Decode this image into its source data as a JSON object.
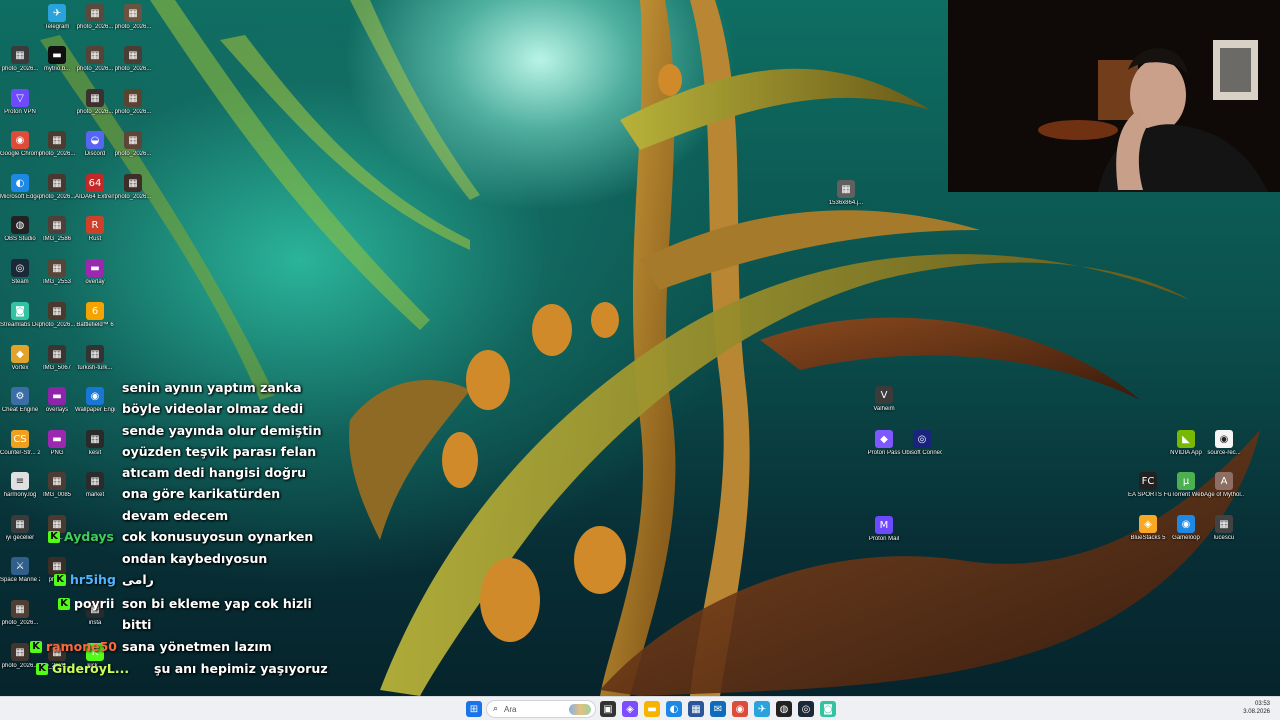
{
  "desktop": {
    "icons_left": [
      {
        "label": "Telegram",
        "color": "#2aa3dc",
        "glyph": "✈"
      },
      {
        "label": "photo_2026...",
        "color": "#5a4a3c",
        "glyph": "▦"
      },
      {
        "label": "photo_2026...",
        "color": "#6a5340",
        "glyph": "▦"
      },
      {
        "label": "photo_2026...",
        "color": "#3b3b3b",
        "glyph": "▦"
      },
      {
        "label": "mytrio.b...",
        "color": "#101010",
        "glyph": "▬"
      },
      {
        "label": "photo_2026...",
        "color": "#554338",
        "glyph": "▦"
      },
      {
        "label": "photo_2026...",
        "color": "#4a3d33",
        "glyph": "▦"
      },
      {
        "label": "Proton VPN",
        "color": "#6d4aff",
        "glyph": "▽"
      },
      {
        "label": "photo_2026...",
        "color": "#3c3030",
        "glyph": "▦"
      },
      {
        "label": "photo_2026...",
        "color": "#5b4332",
        "glyph": "▦"
      },
      {
        "label": "Google Chrome",
        "color": "#dd4b39",
        "glyph": "◉"
      },
      {
        "label": "photo_2026...",
        "color": "#4b3b30",
        "glyph": "▦"
      },
      {
        "label": "Discord",
        "color": "#5865f2",
        "glyph": "◒"
      },
      {
        "label": "photo_2026...",
        "color": "#5d4637",
        "glyph": "▦"
      },
      {
        "label": "Microsoft Edge",
        "color": "#1e88e5",
        "glyph": "◐"
      },
      {
        "label": "photo_2026...",
        "color": "#473830",
        "glyph": "▦"
      },
      {
        "label": "AIDA64 Extreme",
        "color": "#c62828",
        "glyph": "64"
      },
      {
        "label": "photo_2026...",
        "color": "#3c2f2a",
        "glyph": "▦"
      },
      {
        "label": "OBS Studio",
        "color": "#222222",
        "glyph": "◍"
      },
      {
        "label": "IMG_2586",
        "color": "#4e4038",
        "glyph": "▦"
      },
      {
        "label": "Rust",
        "color": "#cd412b",
        "glyph": "R"
      },
      {
        "label": "Steam",
        "color": "#1b2838",
        "glyph": "◎"
      },
      {
        "label": "IMG_2553",
        "color": "#574539",
        "glyph": "▦"
      },
      {
        "label": "overlay",
        "color": "#9c27b0",
        "glyph": "▬"
      },
      {
        "label": "Streamlabs Desktop",
        "color": "#31c3a2",
        "glyph": "◙"
      },
      {
        "label": "photo_2026...",
        "color": "#4a3a2e",
        "glyph": "▦"
      },
      {
        "label": "Battlefield™ 6",
        "color": "#f4a300",
        "glyph": "6"
      },
      {
        "label": "Vortex",
        "color": "#e3a32b",
        "glyph": "◆"
      },
      {
        "label": "IMG_5067",
        "color": "#3e3330",
        "glyph": "▦"
      },
      {
        "label": "turkish-turk...",
        "color": "#333333",
        "glyph": "▦"
      },
      {
        "label": "Cheat Engine",
        "color": "#3a6ea5",
        "glyph": "⚙"
      },
      {
        "label": "overlays",
        "color": "#8e24aa",
        "glyph": "▬"
      },
      {
        "label": "Wallpaper Engine",
        "color": "#1976d2",
        "glyph": "◉"
      },
      {
        "label": "Counter-Str... 2",
        "color": "#f0a020",
        "glyph": "CS"
      },
      {
        "label": "PNG",
        "color": "#9c27b0",
        "glyph": "▬"
      },
      {
        "label": "kesit",
        "color": "#2a2a2a",
        "glyph": "▦"
      },
      {
        "label": "harmony.log",
        "color": "#e0e0e0",
        "glyph": "≡"
      },
      {
        "label": "IMG_0085",
        "color": "#4d3c33",
        "glyph": "▦"
      },
      {
        "label": "market",
        "color": "#2b2b2b",
        "glyph": "▦"
      },
      {
        "label": "iyi gecelier",
        "color": "#3b3b3b",
        "glyph": "▦"
      },
      {
        "label": "ph...",
        "color": "#4a3b30",
        "glyph": "▦"
      },
      {
        "label": "Space Marine 2 (TL)",
        "color": "#2f5f8a",
        "glyph": "⚔"
      },
      {
        "label": "phot...",
        "color": "#3a2e28",
        "glyph": "▦"
      },
      {
        "label": "photo_2026...",
        "color": "#4f3e34",
        "glyph": "▦"
      },
      {
        "label": "insta",
        "color": "#2a2a2a",
        "glyph": "▦"
      },
      {
        "label": "photo_2026...",
        "color": "#423530",
        "glyph": "▦"
      },
      {
        "label": "to_2026...",
        "color": "#3d3029",
        "glyph": "▦"
      },
      {
        "label": "kick...",
        "color": "#53fc18",
        "glyph": "K"
      }
    ],
    "icons_center": [
      {
        "label": "1536x864.j...",
        "color": "#606060",
        "glyph": "▦"
      },
      {
        "label": "Valheim",
        "color": "#3b3b3b",
        "glyph": "V"
      },
      {
        "label": "Proton Pass",
        "color": "#7e57ff",
        "glyph": "◆"
      },
      {
        "label": "Ubisoft Connect",
        "color": "#1a237e",
        "glyph": "◎"
      },
      {
        "label": "Proton Mail",
        "color": "#6d4aff",
        "glyph": "M"
      }
    ],
    "icons_right": [
      {
        "label": "NVIDIA App",
        "color": "#76b900",
        "glyph": "◣"
      },
      {
        "label": "source-rec...",
        "color": "#f5f5f5",
        "glyph": "◉"
      },
      {
        "label": "EA SPORTS FC™ 26",
        "color": "#222222",
        "glyph": "FC"
      },
      {
        "label": "uTorrent Web",
        "color": "#4caf50",
        "glyph": "µ"
      },
      {
        "label": "Age of Mythol...",
        "color": "#8d6e63",
        "glyph": "A"
      },
      {
        "label": "BlueStacks 5",
        "color": "#f9a825",
        "glyph": "◈"
      },
      {
        "label": "Gameloop",
        "color": "#1e88e5",
        "glyph": "◉"
      },
      {
        "label": "lucescu",
        "color": "#424242",
        "glyph": "▦"
      }
    ]
  },
  "chat": {
    "lines": [
      {
        "text": "senin aynın yaptım zanka"
      },
      {
        "text": "böyle videolar olmaz dedi"
      },
      {
        "text": "sende yayında olur demiştin"
      },
      {
        "text": "oyüzden teşvik parası felan"
      },
      {
        "text": "atıcam dedi hangisi doğru"
      },
      {
        "text": "ona göre karikatürden"
      },
      {
        "text": "devam edecem"
      },
      {
        "user": "Aydays",
        "user_color": "#3ecf5a",
        "text": "cok konusuyosun oynarken"
      },
      {
        "text": "ondan kaybedıyosun"
      },
      {
        "user": "hr5ihg",
        "user_color": "#4fb3ff",
        "text": "رامى"
      },
      {
        "user": "poyrii",
        "user_color": "#ffffff",
        "text": "son bi ekleme yap cok hizli"
      },
      {
        "text": "bitti"
      },
      {
        "user": "ramone50",
        "user_color": "#ff6a3d",
        "text": "sana yönetmen lazım"
      },
      {
        "user": "GideroyL...",
        "user_color": "#c8ff5a",
        "text": "şu anı hepimiz yaşıyoruz"
      }
    ],
    "badge_letter": "K"
  },
  "taskbar": {
    "search_placeholder": "Ara",
    "time": "03:53",
    "date": "3.08.2026",
    "items": [
      {
        "name": "windows-start",
        "color": "#1a73e8",
        "glyph": "⊞"
      },
      {
        "name": "widgets",
        "color": "#5a7fb0",
        "glyph": "☁"
      },
      {
        "name": "task-view",
        "color": "#333333",
        "glyph": "▣"
      },
      {
        "name": "copilot",
        "color": "#7b4dff",
        "glyph": "◈"
      },
      {
        "name": "file-explorer",
        "color": "#f5b400",
        "glyph": "▬"
      },
      {
        "name": "edge",
        "color": "#1e88e5",
        "glyph": "◐"
      },
      {
        "name": "ms-store",
        "color": "#2b579a",
        "glyph": "▦"
      },
      {
        "name": "mail",
        "color": "#0f6cbd",
        "glyph": "✉"
      },
      {
        "name": "chrome",
        "color": "#dd4b39",
        "glyph": "◉"
      },
      {
        "name": "telegram",
        "color": "#2aa3dc",
        "glyph": "✈"
      },
      {
        "name": "obs",
        "color": "#222222",
        "glyph": "◍"
      },
      {
        "name": "steam",
        "color": "#1b2838",
        "glyph": "◎"
      },
      {
        "name": "streamlabs",
        "color": "#31c3a2",
        "glyph": "◙"
      }
    ]
  }
}
